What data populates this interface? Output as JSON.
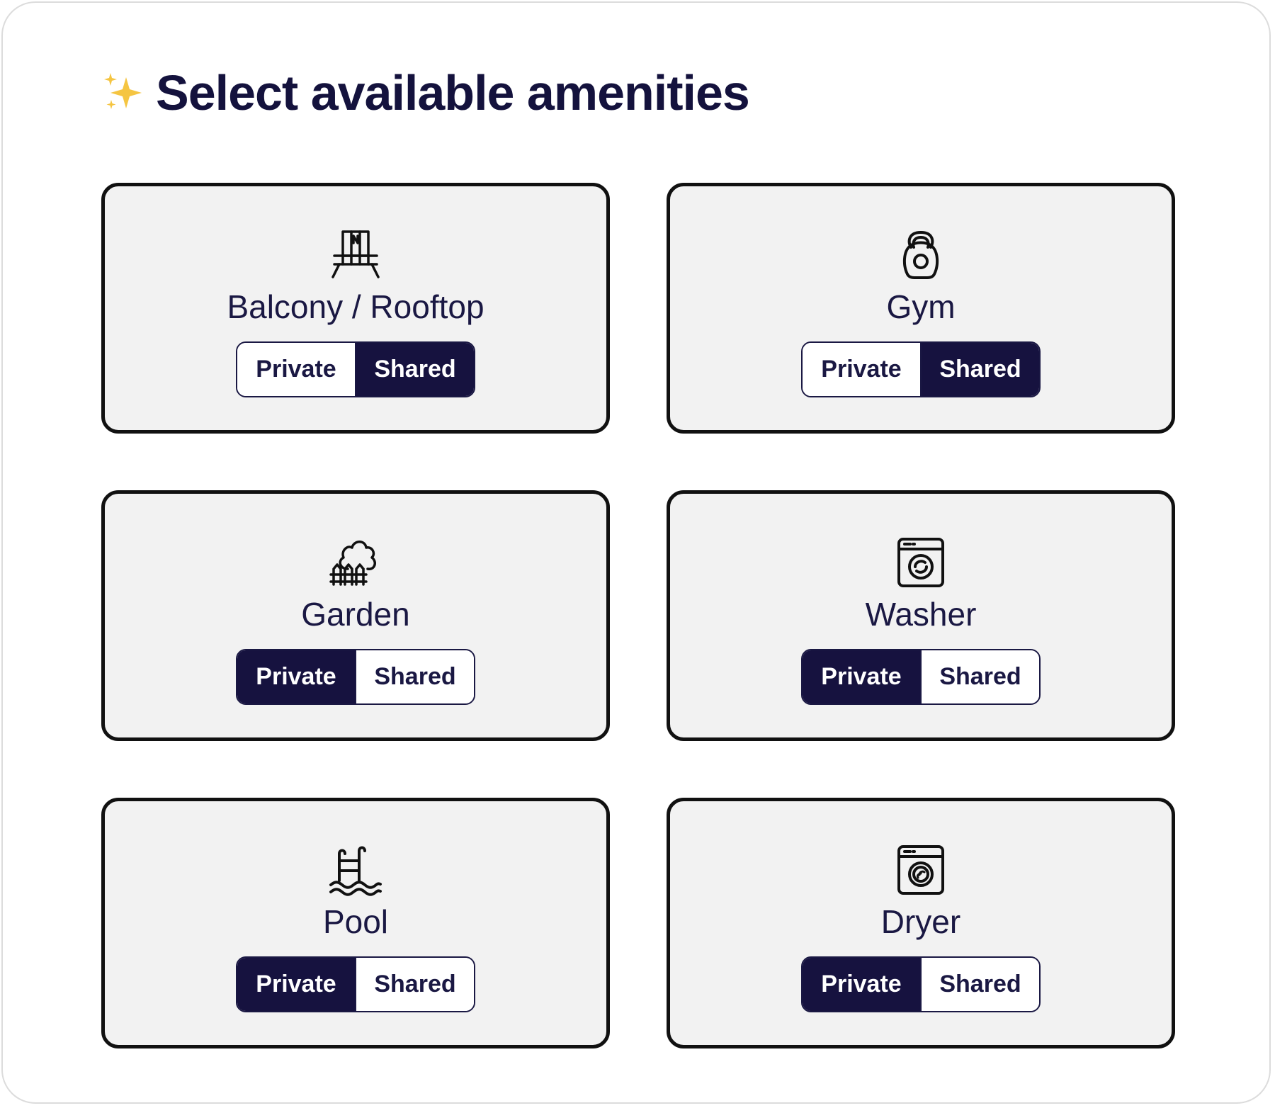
{
  "header": {
    "icon": "sparkles-icon",
    "title": "Select available amenities"
  },
  "colors": {
    "accent": "#16123f",
    "sparkle": "#f5c542",
    "card_background": "#f2f2f2"
  },
  "amenities": [
    {
      "label": "Balcony / Rooftop",
      "icon": "balcony-icon",
      "options": [
        "Private",
        "Shared"
      ],
      "selected": "Shared"
    },
    {
      "label": "Gym",
      "icon": "kettlebell-icon",
      "options": [
        "Private",
        "Shared"
      ],
      "selected": "Shared"
    },
    {
      "label": "Garden",
      "icon": "garden-icon",
      "options": [
        "Private",
        "Shared"
      ],
      "selected": "Private"
    },
    {
      "label": "Washer",
      "icon": "washing-machine-icon",
      "options": [
        "Private",
        "Shared"
      ],
      "selected": "Private"
    },
    {
      "label": "Pool",
      "icon": "pool-ladder-icon",
      "options": [
        "Private",
        "Shared"
      ],
      "selected": "Private"
    },
    {
      "label": "Dryer",
      "icon": "dryer-icon",
      "options": [
        "Private",
        "Shared"
      ],
      "selected": "Private"
    }
  ]
}
